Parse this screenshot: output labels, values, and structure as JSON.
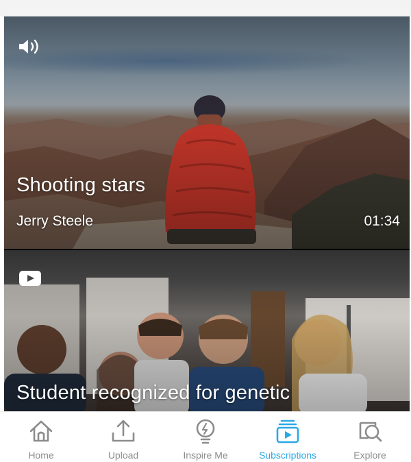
{
  "feed": {
    "cards": [
      {
        "title": "Shooting stars",
        "author": "Jerry Steele",
        "duration": "01:34",
        "badge_icon": "sound-icon"
      },
      {
        "title": "Student recognized for genetic",
        "badge_icon": "youtube-icon"
      }
    ]
  },
  "tabbar": {
    "active_color": "#2aa8e6",
    "inactive_color": "#8c8c8c",
    "tabs": [
      {
        "label": "Home",
        "icon": "home-icon",
        "active": false
      },
      {
        "label": "Upload",
        "icon": "upload-icon",
        "active": false
      },
      {
        "label": "Inspire Me",
        "icon": "lightbulb-icon",
        "active": false
      },
      {
        "label": "Subscriptions",
        "icon": "subscriptions-icon",
        "active": true
      },
      {
        "label": "Explore",
        "icon": "explore-search-icon",
        "active": false
      }
    ]
  }
}
